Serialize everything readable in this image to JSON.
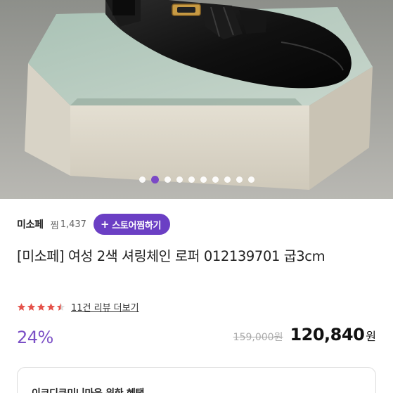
{
  "gallery": {
    "image_icon": "black-leather-loafer-photo",
    "dot_count": 10,
    "active_index": 1,
    "colors": {
      "active_dot": "#7b49c6",
      "inactive_dot": "#ffffff"
    }
  },
  "seller": {
    "name": "미소페",
    "zzim_label": "찜",
    "zzim_count": "1,437",
    "zzim_button_icon": "+",
    "zzim_button_label": "스토어찜하기",
    "colors": {
      "button": "#6b3fc4"
    }
  },
  "product": {
    "title": "[미소페] 여성 2색 셔링체인 로퍼 012139701 굽3cm"
  },
  "rating": {
    "score": 4.5,
    "max": 5,
    "review_link": "11건 리뷰 더보기",
    "colors": {
      "star": "#e5534b"
    }
  },
  "price": {
    "discount": "24%",
    "original": "159,000원",
    "sale": "120,840",
    "currency": "원",
    "colors": {
      "discount": "#7b4fc6"
    }
  },
  "benefit": {
    "text": "이코디큐미니마음 위한 혜택"
  }
}
